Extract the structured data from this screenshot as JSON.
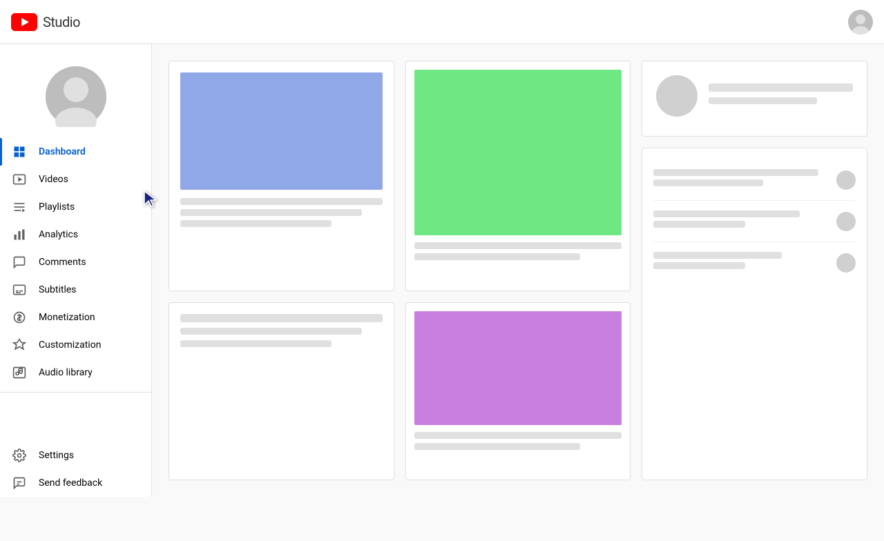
{
  "header": {
    "title": "Studio",
    "logo_alt": "YouTube Studio logo"
  },
  "sidebar": {
    "channel_avatar_alt": "Channel avatar",
    "nav_items": [
      {
        "id": "dashboard",
        "label": "Dashboard",
        "icon": "dashboard-icon",
        "active": true
      },
      {
        "id": "videos",
        "label": "Videos",
        "icon": "videos-icon",
        "active": false
      },
      {
        "id": "playlists",
        "label": "Playlists",
        "icon": "playlists-icon",
        "active": false
      },
      {
        "id": "analytics",
        "label": "Analytics",
        "icon": "analytics-icon",
        "active": false
      },
      {
        "id": "comments",
        "label": "Comments",
        "icon": "comments-icon",
        "active": false
      },
      {
        "id": "subtitles",
        "label": "Subtitles",
        "icon": "subtitles-icon",
        "active": false
      },
      {
        "id": "monetization",
        "label": "Monetization",
        "icon": "monetization-icon",
        "active": false
      },
      {
        "id": "customization",
        "label": "Customization",
        "icon": "customization-icon",
        "active": false
      },
      {
        "id": "audio-library",
        "label": "Audio library",
        "icon": "audio-library-icon",
        "active": false
      }
    ],
    "bottom_items": [
      {
        "id": "settings",
        "label": "Settings",
        "icon": "settings-icon"
      },
      {
        "id": "send-feedback",
        "label": "Send feedback",
        "icon": "feedback-icon"
      }
    ]
  },
  "main": {
    "card1": {
      "thumbnail_color": "#90a7e8"
    },
    "card2": {
      "thumbnail_color": "#6ee882"
    },
    "card3": {
      "thumbnail_color": "#c97fe0"
    }
  },
  "colors": {
    "accent": "#065fd4",
    "active_nav": "#065fd4",
    "yt_red": "#ff0000"
  }
}
